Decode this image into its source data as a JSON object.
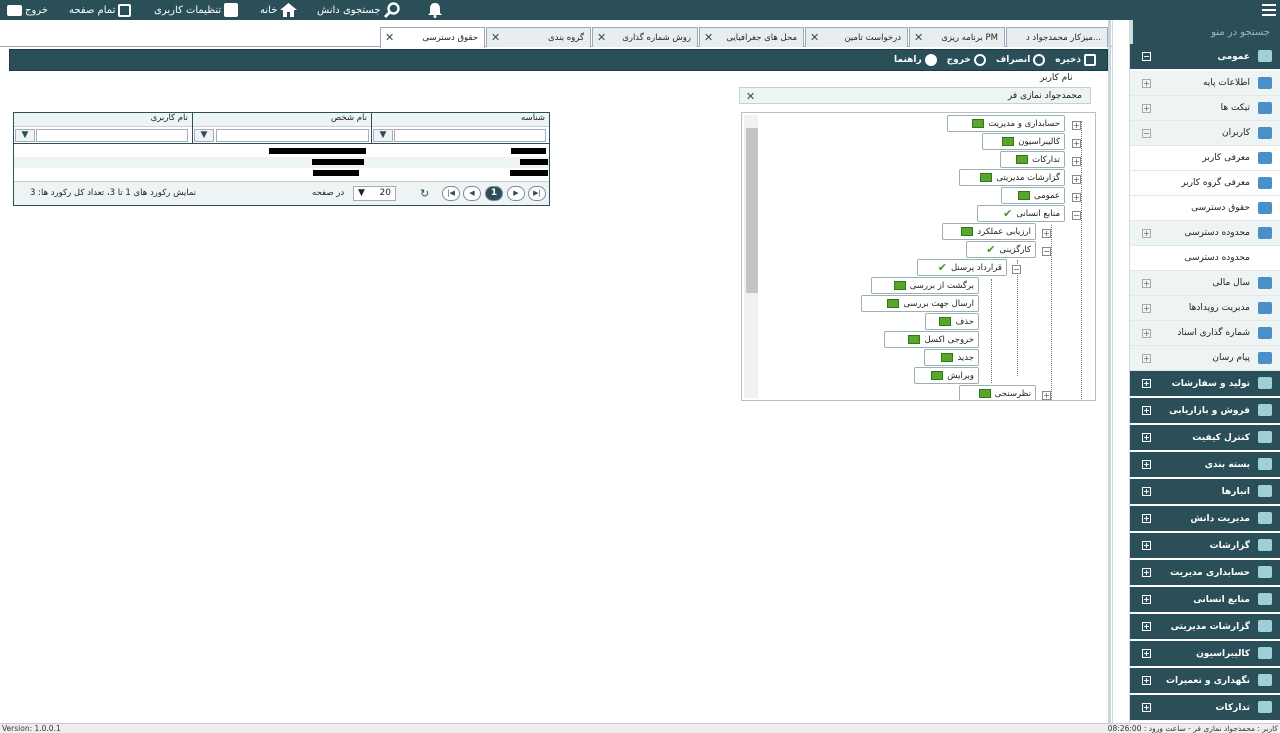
{
  "topbar": {
    "exit": "خروج",
    "fullscreen": "تمام صفحه",
    "user_settings": "تنظیمات کاربری",
    "home": "خانه",
    "knowledge_search": "جستجوی دانش"
  },
  "tabs": [
    {
      "label": "میزکار محمدجواد د..."
    },
    {
      "label": "برنامه ریزی PM"
    },
    {
      "label": "درخواست تامین"
    },
    {
      "label": "محل های جغرافیایی"
    },
    {
      "label": "روش شماره گذاری"
    },
    {
      "label": "گروه بندی"
    },
    {
      "label": "حقوق دسترسی"
    }
  ],
  "toolbar": {
    "save": "ذخیره",
    "cancel": "انصراف",
    "exit": "خروج",
    "help": "راهنما"
  },
  "user_field": {
    "label": "نام کاربر",
    "value": "محمدجواد نمازی فر"
  },
  "tree": {
    "nodes": [
      "حسابداری و مدیریت",
      "کالیبراسیون",
      "تدارکات",
      "گزارشات مدیریتی",
      "عمومی",
      "منابع انسانی",
      "ارزیابی عملکرد",
      "کارگزینی",
      "قرارداد پرسنل",
      "برگشت از بررسی",
      "ارسال جهت بررسی",
      "حذف",
      "خروجی اکسل",
      "جدید",
      "ویرایش",
      "نظرسنجی"
    ]
  },
  "grid": {
    "headers": [
      "شناسه",
      "نام شخص",
      "نام کاربری"
    ],
    "footer": {
      "summary": "نمایش رکورد های 1 تا 3، تعداد کل رکورد ها: 3",
      "page_size": "20",
      "per_page": "در صفحه",
      "current_page": "1"
    }
  },
  "sidebar": {
    "search_placeholder": "جستجو در منو",
    "items": [
      {
        "label": "عمومی",
        "level": "top",
        "icon": "gears-icon"
      },
      {
        "label": "اطلاعات پایه",
        "level": "sub",
        "icon": "grid-icon"
      },
      {
        "label": "تیکت ها",
        "level": "sub",
        "icon": "ticket-icon"
      },
      {
        "label": "کاربران",
        "level": "sub",
        "icon": "user-plus-icon"
      },
      {
        "label": "معرفی کاربر",
        "level": "sub2",
        "icon": "user-plus-icon"
      },
      {
        "label": "معرفی گروه کاربر",
        "level": "sub2",
        "icon": "users-icon"
      },
      {
        "label": "حقوق دسترسی",
        "level": "sub2",
        "icon": "card-icon"
      },
      {
        "label": "محدوده دسترسی",
        "level": "sub",
        "icon": "accessibility-icon"
      },
      {
        "label": "محدوده دسترسی",
        "level": "sub2",
        "icon": ""
      },
      {
        "label": "سال مالی",
        "level": "sub",
        "icon": "calendar-icon"
      },
      {
        "label": "مدیریت رویدادها",
        "level": "sub",
        "icon": "bolt-icon"
      },
      {
        "label": "شماره گذاری اسناد",
        "level": "sub",
        "icon": "list-icon"
      },
      {
        "label": "پیام رسان",
        "level": "sub",
        "icon": "chat-icon"
      },
      {
        "label": "تولید و سفارشات",
        "level": "top",
        "icon": "book-icon"
      },
      {
        "label": "فروش و بازاریابی",
        "level": "top",
        "icon": "dollar-icon"
      },
      {
        "label": "کنترل کیفیت",
        "level": "top",
        "icon": "flask-icon"
      },
      {
        "label": "بسته بندی",
        "level": "top",
        "icon": "box-icon"
      },
      {
        "label": "انبارها",
        "level": "top",
        "icon": "truck-icon"
      },
      {
        "label": "مدیریت دانش",
        "level": "top",
        "icon": "book-icon"
      },
      {
        "label": "گزارشات",
        "level": "top",
        "icon": "chart-icon"
      },
      {
        "label": "حسابداری مدیریت",
        "level": "top",
        "icon": "amazon-icon"
      },
      {
        "label": "منابع انسانی",
        "level": "top",
        "icon": "users-icon"
      },
      {
        "label": "گزارشات مدیریتی",
        "level": "top",
        "icon": "dashboard-icon"
      },
      {
        "label": "کالیبراسیون",
        "level": "top",
        "icon": "thermometer-icon"
      },
      {
        "label": "نگهداری و تعمیرات",
        "level": "top",
        "icon": "wrench-icon"
      },
      {
        "label": "تدارکات",
        "level": "top",
        "icon": "cloud-icon"
      }
    ]
  },
  "status": {
    "version": "Version: 1.0.0.1",
    "user_info": "کاربر : محمدجواد نمازی فر - ساعت ورود : 08:26:00"
  },
  "colors": {
    "primary": "#2a4f58",
    "folder_green": "#5aa52c"
  }
}
